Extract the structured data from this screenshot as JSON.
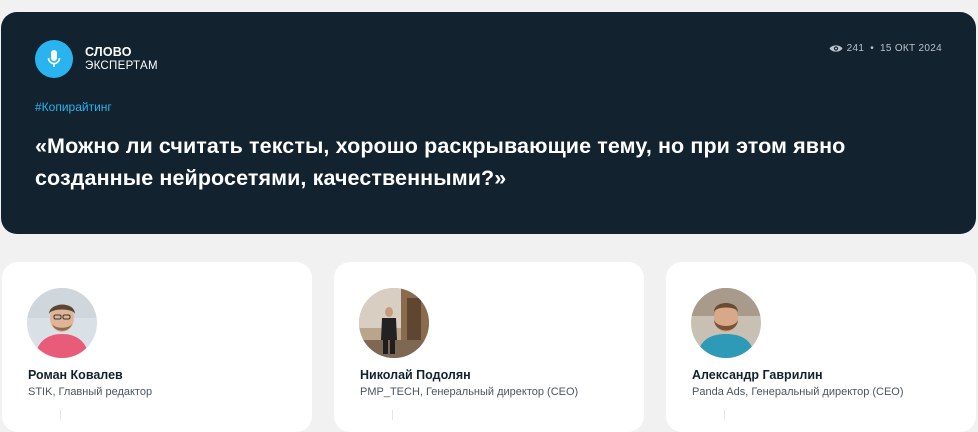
{
  "brand": {
    "line1": "СЛОВО",
    "line2": "ЭКСПЕРТАМ",
    "icon": "microphone-icon",
    "accent": "#2ab4ef"
  },
  "meta": {
    "views": "241",
    "date": "15 ОКТ 2024",
    "icon": "eye-icon"
  },
  "tag": "#Копирайтинг",
  "headline": "«Можно ли считать тексты, хорошо раскрывающие тему, но при этом явно созданные нейросетями, качественными?»",
  "colors": {
    "hero_bg": "#12222f",
    "page_bg": "#f1f1f1",
    "tag": "#29b3ee"
  },
  "experts": [
    {
      "name": "Роман Ковалев",
      "role": "STIK, Главный редактор"
    },
    {
      "name": "Николай Подолян",
      "role": "PMP_TECH, Генеральный директор (CEO)"
    },
    {
      "name": "Александр Гаврилин",
      "role": "Panda Ads, Генеральный директор (CEO)"
    }
  ]
}
